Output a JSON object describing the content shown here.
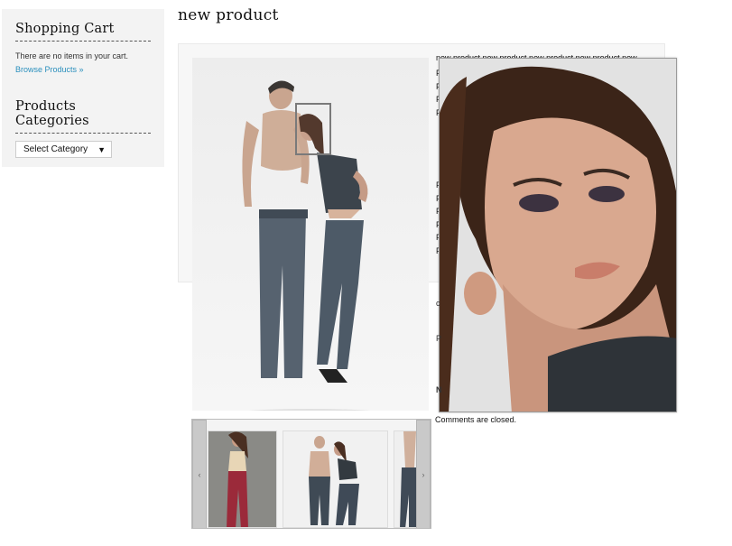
{
  "sidebar": {
    "cart_title": "Shopping Cart",
    "cart_empty_text": "There are no items in your cart.",
    "browse_link": "Browse Products »",
    "categories_title": "Products Categories",
    "select_value": "Select Category"
  },
  "post": {
    "title": "new product",
    "description_top": "new product new product new product new product new",
    "description_letter": "P",
    "comments_text": "Comments are closed."
  },
  "carousel": {
    "prev_label": "‹",
    "next_label": "›"
  },
  "icons": {
    "select_arrow": "triangle-down-icon",
    "prev": "chevron-left-icon",
    "next": "chevron-right-icon"
  },
  "colors": {
    "link": "#2a8fbd",
    "sidebar_bg": "#f3f3f3"
  }
}
